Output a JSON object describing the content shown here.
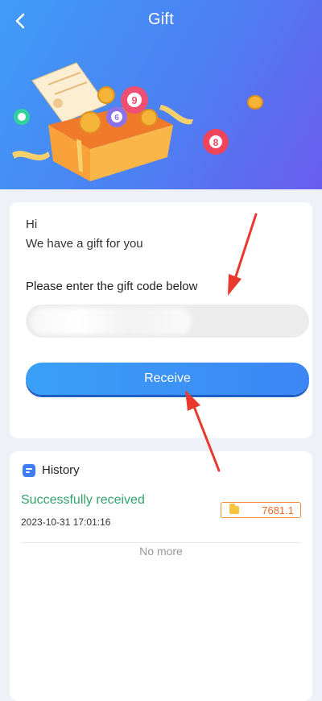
{
  "header": {
    "title": "Gift",
    "accent_start": "#3f9cf7",
    "accent_end": "#6a5cf0"
  },
  "illustration": {
    "ball_numbers": [
      "9",
      "6",
      "8"
    ]
  },
  "gift": {
    "greeting": "Hi",
    "message": "We have a gift for you",
    "prompt": "Please enter the gift code below",
    "input_value": "",
    "receive_label": "Receive"
  },
  "history": {
    "title": "History",
    "entries": [
      {
        "status": "Successfully received",
        "timestamp": "2023-10-31 17:01:16",
        "amount": "7681.1"
      }
    ],
    "no_more": "No more"
  },
  "colors": {
    "button": "#3d86f5",
    "success": "#33a36b",
    "amount": "#ef6b2b",
    "annotation_arrow": "#e8392e"
  }
}
